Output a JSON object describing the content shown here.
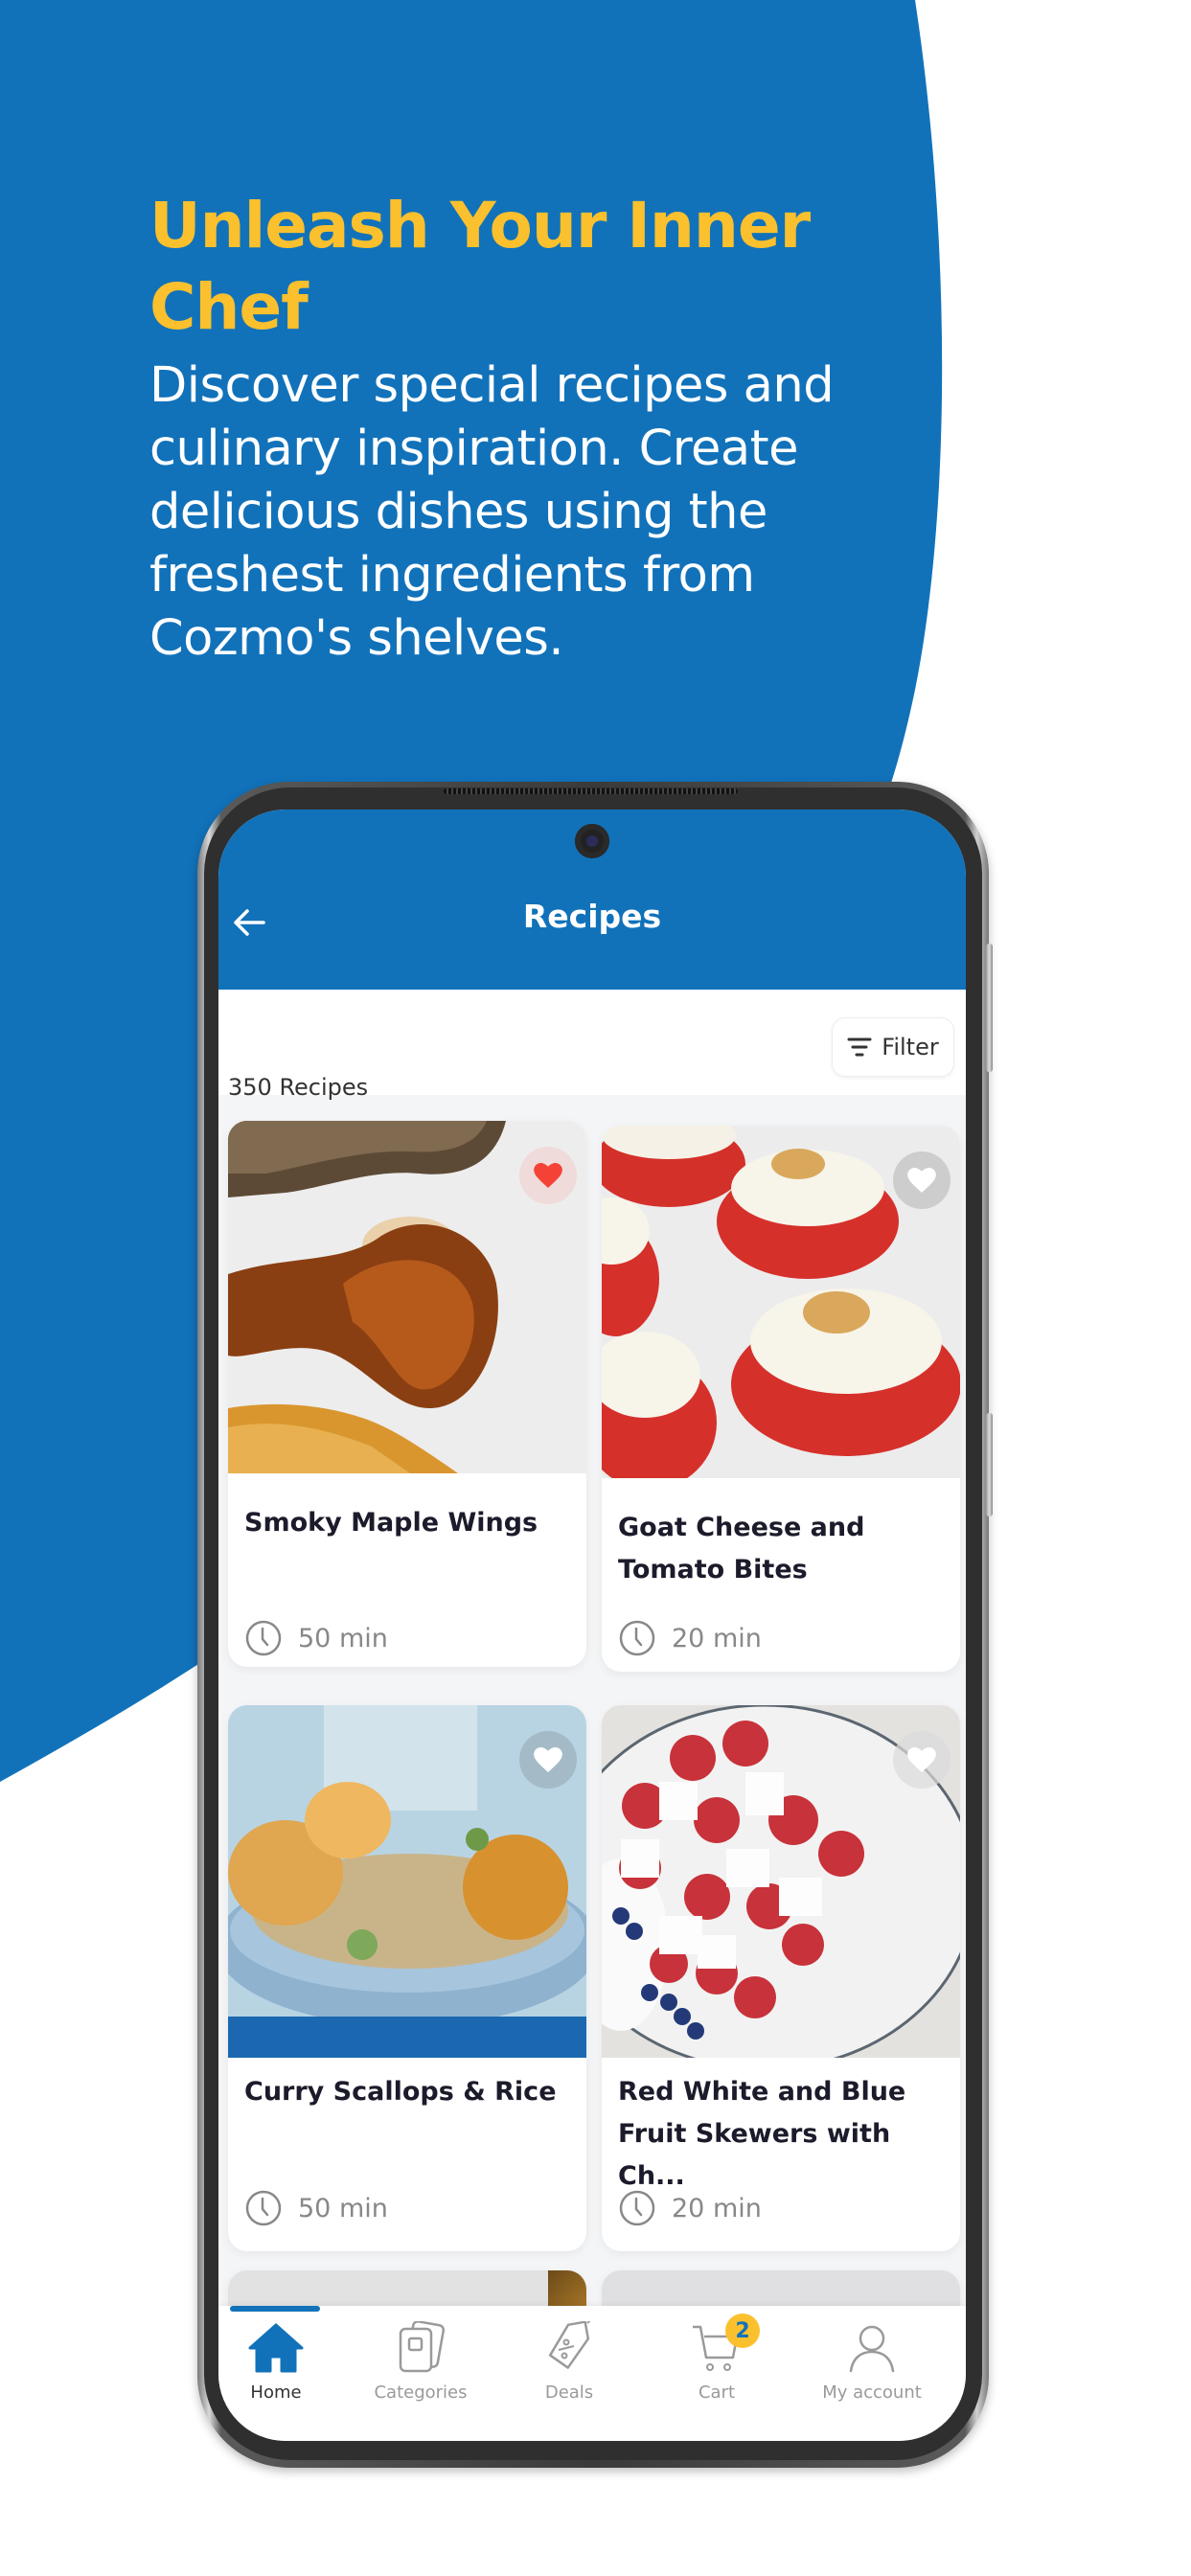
{
  "hero": {
    "headline": "Unleash Your Inner Chef",
    "body": "Discover special recipes and culinary inspiration. Create delicious dishes using the freshest ingredients from Cozmo's shelves."
  },
  "colors": {
    "brand_blue": "#1172BA",
    "accent_yellow": "#FBC02D",
    "favorite_red": "#F44336"
  },
  "app": {
    "header": {
      "title": "Recipes",
      "back_icon": "arrow-left-icon"
    },
    "toolbar": {
      "count_label": "350 Recipes",
      "filter_label": "Filter",
      "filter_icon": "filter-lines-icon"
    },
    "recipes": [
      {
        "title": "Smoky Maple Wings",
        "time": "50 min",
        "favorited": true,
        "image": "chicken-wings-photo"
      },
      {
        "title": "Goat Cheese and Tomato Bites",
        "time": "20 min",
        "favorited": false,
        "image": "tomato-goat-cheese-photo"
      },
      {
        "title": "Curry Scallops & Rice",
        "time": "50 min",
        "favorited": false,
        "image": "scallops-rice-photo"
      },
      {
        "title": "Red White and Blue Fruit Skewers with Ch...",
        "time": "20 min",
        "favorited": false,
        "image": "fruit-skewers-photo"
      }
    ],
    "bottom_nav": {
      "active": "Home",
      "items": [
        {
          "label": "Home",
          "icon": "home-icon"
        },
        {
          "label": "Categories",
          "icon": "categories-icon"
        },
        {
          "label": "Deals",
          "icon": "tag-icon"
        },
        {
          "label": "Cart",
          "icon": "cart-icon",
          "badge": "2"
        },
        {
          "label": "My account",
          "icon": "user-icon"
        }
      ]
    }
  }
}
